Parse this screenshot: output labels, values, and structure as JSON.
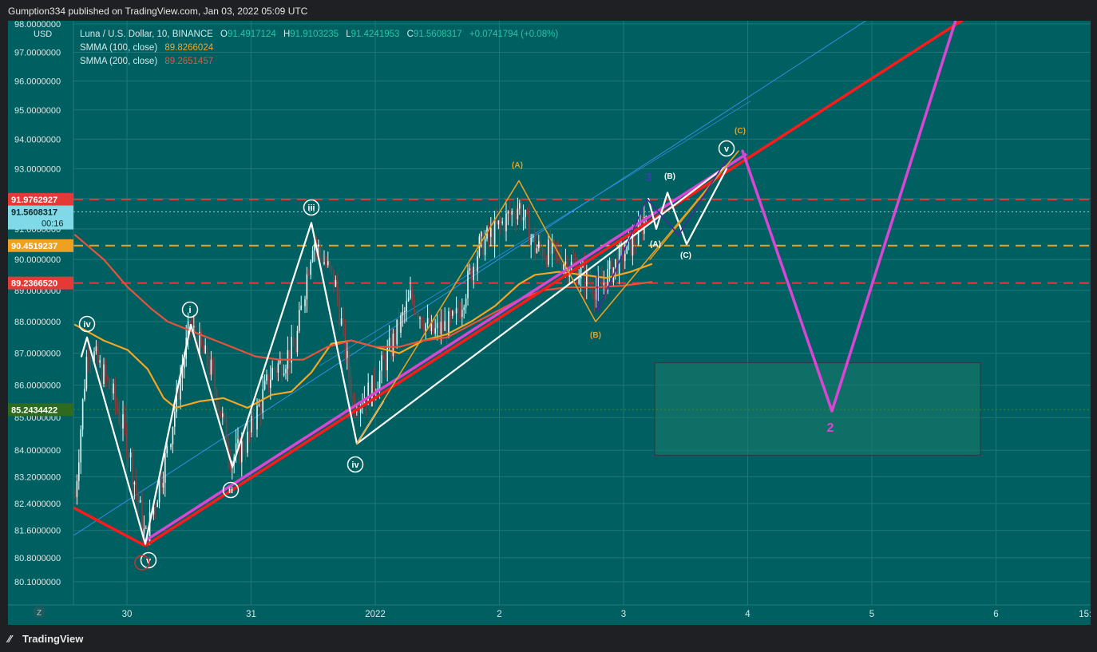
{
  "header": {
    "published_by": "Gumption334 published on TradingView.com, Jan 03, 2022 05:09 UTC"
  },
  "legend": {
    "symbol": "Luna / U.S. Dollar, 10, BINANCE",
    "open_label": "O",
    "open": "91.4917124",
    "high_label": "H",
    "high": "91.9103235",
    "low_label": "L",
    "low": "91.4241953",
    "close_label": "C",
    "close": "91.5608317",
    "change": "+0.0741794 (+0.08%)",
    "smma100_label": "SMMA (100, close)",
    "smma100_value": "89.8266024",
    "smma200_label": "SMMA (200, close)",
    "smma200_value": "89.2651457",
    "currency": "USD"
  },
  "footer": {
    "brand": "TradingView"
  },
  "colors": {
    "background": "#005f61",
    "grid": "#1f7779",
    "bull_candle": "#e8f6f5",
    "bear_candle": "#8f3b3f",
    "red_level": "#e53935",
    "orange_level": "#f0a020",
    "smma100": "#f5a623",
    "smma200": "#e5533d",
    "wave_magenta": "#d946d4",
    "trend_red": "#ff1a1a",
    "wave_white": "#ffffff",
    "wave_orange": "#e8a020",
    "channel_blue": "#2f8fe0",
    "zone": "#1b7a6c"
  },
  "chart_data": {
    "type": "candlestick",
    "symbol": "Luna / U.S. Dollar",
    "interval": "10",
    "exchange": "BINANCE",
    "x_ticks": [
      "30",
      "31",
      "2022",
      "2",
      "3",
      "4",
      "5",
      "6",
      "15:00"
    ],
    "y_ticks": [
      "98.0000000",
      "97.0000000",
      "96.0000000",
      "95.0000000",
      "94.0000000",
      "93.0000000",
      "92.0000000",
      "91.0000000",
      "90.0000000",
      "89.0000000",
      "88.0000000",
      "87.0000000",
      "86.0000000",
      "85.0000000",
      "84.0000000",
      "83.2000000",
      "82.4000000",
      "81.6000000",
      "80.8000000",
      "80.1000000"
    ],
    "y_scale": "log",
    "ylim": [
      79.5,
      98.4
    ],
    "price_labels": [
      {
        "value": 91.9762927,
        "text": "91.9762927",
        "color": "#e53935",
        "style": "dashed"
      },
      {
        "value": 91.5608317,
        "text": "91.5608317",
        "sub": "00:16",
        "color": "#7fd9e6",
        "style": "dotted"
      },
      {
        "value": 90.4519237,
        "text": "90.4519237",
        "color": "#f0a020",
        "style": "dashed"
      },
      {
        "value": 89.236652,
        "text": "89.2366520",
        "color": "#e53935",
        "style": "dashed"
      },
      {
        "value": 85.2434422,
        "text": "85.2434422",
        "color": "#2e6b1f",
        "style": "dotted"
      }
    ],
    "wave_labels": {
      "circled": [
        "iv",
        "v",
        "i",
        "ii",
        "iii",
        "iv",
        "v"
      ],
      "corrective": [
        "(A)",
        "(B)",
        "(C)",
        "(A)",
        "(B)",
        "(C)"
      ],
      "primary": [
        "3",
        "2"
      ]
    },
    "series": [
      {
        "name": "SMMA (100, close)",
        "last_value": 89.8266024
      },
      {
        "name": "SMMA (200, close)",
        "last_value": 89.2651457
      }
    ],
    "grid": true
  }
}
